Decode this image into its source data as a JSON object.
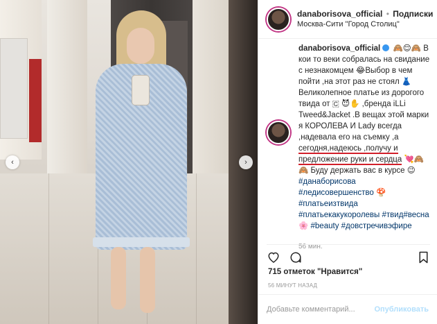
{
  "post": {
    "username": "danaborisova_official",
    "separator": "•",
    "follow_label": "Подписки",
    "location": "Москва-Сити \"Город Столиц\""
  },
  "caption": {
    "username": "danaborisova_official",
    "line1": "🙈😌🙈 В кои то веки собралась на свидание с незнакомцем 😂Выбор в чем пойти ,на этот раз не стоял 👗",
    "line2": "Великолепное платье из дорогого твида от 🇨 😈✋ ,бренда iLLi Tweed&Jacket .В вещах этой марки я КОРОЛЕВА И Lady всегда ,надевала его на съемку ,а",
    "underlined": "сегодня,надеюсь ,получу и предложение руки и сердца",
    "line3": "💘🙈🙈 Буду держать вас в курсе 😉",
    "hashtags": "#данаборисова #ледисовершенство 🍄 #платьеизтвида #платьекакукоролевы #твид#весна 🌸 #beauty #довстречивэфире",
    "time_ago": "56 мин."
  },
  "stats": {
    "likes": "715 отметок \"Нравится\"",
    "posted": "56 МИНУТ НАЗАД"
  },
  "comment_form": {
    "placeholder": "Добавьте комментарий...",
    "submit_label": "Опубликовать"
  },
  "nav": {
    "prev": "‹",
    "next": "›"
  },
  "colors": {
    "hashtag": "#003569",
    "verified": "#3897f0",
    "underline": "#d21f2a"
  }
}
